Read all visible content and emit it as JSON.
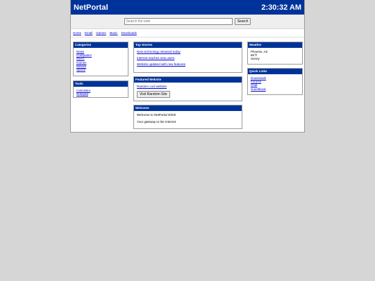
{
  "header": {
    "title": "NetPortal",
    "clock": "2:30:32 AM"
  },
  "search": {
    "placeholder": "Search the web",
    "value": "",
    "button_label": "Search"
  },
  "nav": [
    "Home",
    "Email",
    "Games",
    "Music",
    "Downloads"
  ],
  "categories": {
    "title": "Categories",
    "items": [
      "News",
      "Computers",
      "Music",
      "Games",
      "Movies",
      "Sports"
    ]
  },
  "tools": {
    "title": "Tools",
    "items": [
      "Calculator",
      "Notepad"
    ]
  },
  "top_stories": {
    "title": "Top Stories",
    "items": [
      "New technology released today",
      "Internet reaches new users",
      "Website updated with new features"
    ]
  },
  "featured": {
    "title": "Featured Website",
    "link": "Random cool website",
    "button_label": "Visit Random Site"
  },
  "welcome": {
    "title": "Welcome",
    "line1": "Welcome to NetPortal 2003!",
    "line2": "Your gateway to the Internet."
  },
  "weather": {
    "title": "Weather",
    "location": "Phoenix, AZ",
    "temp": "86°F",
    "condition": "Sunny"
  },
  "quick_links": {
    "title": "Quick Links",
    "items": [
      "Downloads",
      "Forums",
      "Chat",
      "Guestbook"
    ]
  }
}
